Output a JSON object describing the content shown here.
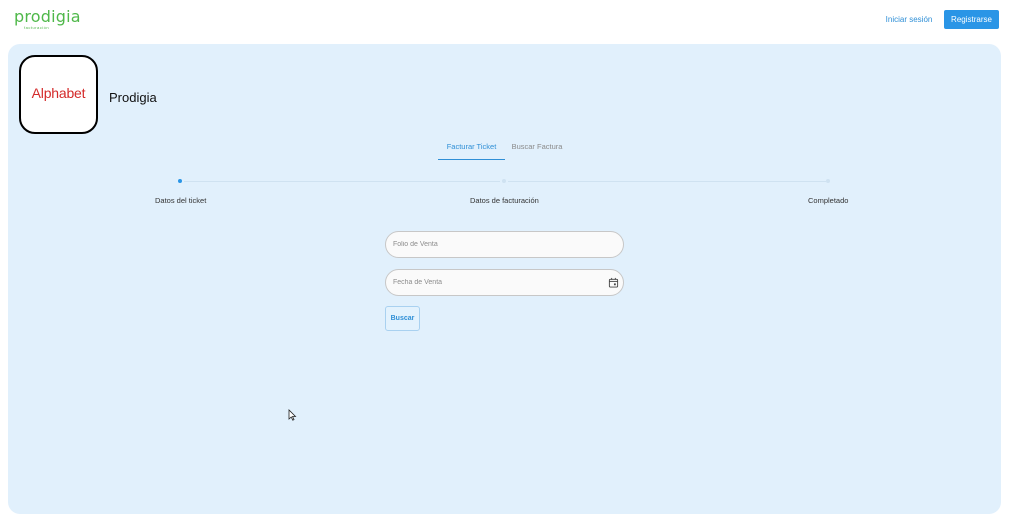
{
  "brand": {
    "logo_text": "prodigia",
    "logo_subtext": "facturación",
    "color": "#4fb84a"
  },
  "header": {
    "login_label": "Iniciar sesión",
    "register_label": "Registrarse",
    "accent_color": "#2a95e6"
  },
  "company": {
    "logo_text": "Alphabet",
    "name": "Prodigia"
  },
  "tabs": [
    {
      "label": "Facturar Ticket",
      "active": true
    },
    {
      "label": "Buscar Factura",
      "active": false
    }
  ],
  "stepper": {
    "current_step": 1,
    "steps": [
      {
        "label": "Datos del ticket"
      },
      {
        "label": "Datos de facturación"
      },
      {
        "label": "Completado"
      }
    ]
  },
  "form": {
    "folio": {
      "placeholder": "Folio de Venta",
      "value": ""
    },
    "fecha": {
      "placeholder": "Fecha de Venta",
      "value": ""
    },
    "search_label": "Buscar"
  },
  "icons": {
    "calendar": "calendar-icon",
    "cursor": "mouse-pointer-icon"
  }
}
